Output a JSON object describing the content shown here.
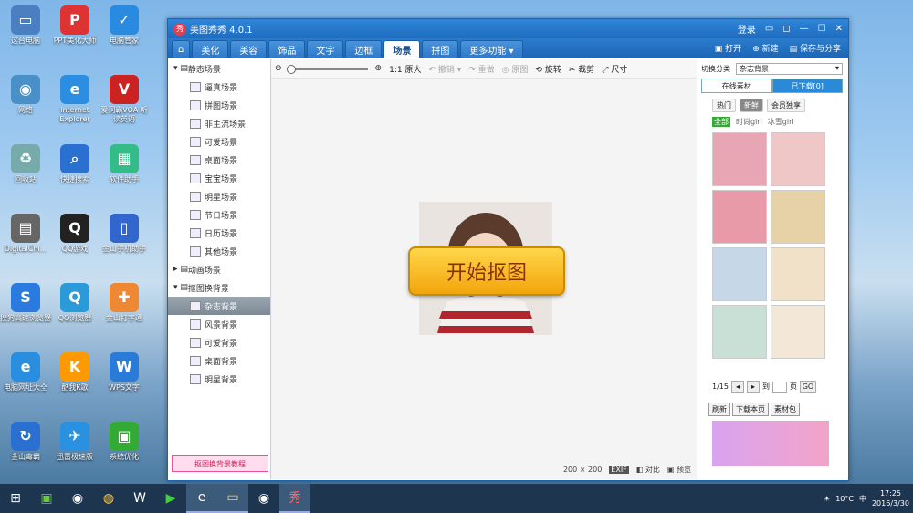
{
  "desktop": {
    "icons": [
      {
        "label": "这台电脑",
        "color": "#4a7fc1",
        "glyph": "▭"
      },
      {
        "label": "PPT美化大师",
        "color": "#d33",
        "glyph": "P"
      },
      {
        "label": "电脑管家",
        "color": "#2a8ae0",
        "glyph": "✓"
      },
      {
        "label": "网络",
        "color": "#4a90c8",
        "glyph": "◉"
      },
      {
        "label": "Internet Explorer",
        "color": "#2c8ee0",
        "glyph": "e"
      },
      {
        "label": "爱词霸VOA 听读英语",
        "color": "#c22",
        "glyph": "V"
      },
      {
        "label": "回收站",
        "color": "#7aa",
        "glyph": "♻"
      },
      {
        "label": "快捷搜索",
        "color": "#2a70d0",
        "glyph": "⌕"
      },
      {
        "label": "软件助手",
        "color": "#3b8",
        "glyph": "▦"
      },
      {
        "label": "DigitalChi...",
        "color": "#666",
        "glyph": "▤"
      },
      {
        "label": "QQ游戏",
        "color": "#222",
        "glyph": "Q"
      },
      {
        "label": "金山手机助手",
        "color": "#36c",
        "glyph": "▯"
      },
      {
        "label": "搜狗高速浏览器",
        "color": "#2a7ae0",
        "glyph": "S"
      },
      {
        "label": "QQ浏览器",
        "color": "#2a9ad8",
        "glyph": "Q"
      },
      {
        "label": "金山打字通",
        "color": "#e83",
        "glyph": "✚"
      },
      {
        "label": "电脑网址大全",
        "color": "#2a8ee0",
        "glyph": "e"
      },
      {
        "label": "酷我K歌",
        "color": "#f90",
        "glyph": "K"
      },
      {
        "label": "WPS文字",
        "color": "#2a7ad8",
        "glyph": "W"
      },
      {
        "label": "金山毒霸",
        "color": "#2a70d0",
        "glyph": "↻"
      },
      {
        "label": "迅雷极速版",
        "color": "#2a90e0",
        "glyph": "✈"
      },
      {
        "label": "系统优化",
        "color": "#3a3",
        "glyph": "▣"
      }
    ]
  },
  "app": {
    "title": "美图秀秀 4.0.1",
    "title_links": [
      "登录"
    ],
    "tabs": [
      {
        "label": "美化"
      },
      {
        "label": "美容"
      },
      {
        "label": "饰品"
      },
      {
        "label": "文字"
      },
      {
        "label": "边框"
      },
      {
        "label": "场景"
      },
      {
        "label": "拼图"
      },
      {
        "label": "更多功能 ▾"
      }
    ],
    "active_tab": "场景",
    "actions": {
      "open": "打开",
      "new": "新建",
      "save": "保存与分享"
    },
    "tree": {
      "static_header": "静态场景",
      "static_items": [
        "逼真场景",
        "拼图场景",
        "非主流场景",
        "可爱场景",
        "桌面场景",
        "宝宝场景",
        "明星场景",
        "节日场景",
        "日历场景",
        "其他场景"
      ],
      "animated": "动画场景",
      "cutout_header": "抠图换背景",
      "cutout_items": [
        "杂志背景",
        "风景背景",
        "可爱背景",
        "桌面背景",
        "明星背景"
      ],
      "selected": "杂志背景",
      "tutorial": "抠图换背景教程"
    },
    "toolbar": {
      "zoom_label": "1:1 原大",
      "undo": "撤销",
      "redo": "重做",
      "original": "原图",
      "rotate": "旋转",
      "crop": "裁剪",
      "resize": "尺寸"
    },
    "canvas": {
      "start_button": "开始抠图",
      "size": "200 × 200",
      "exif": "EXIF",
      "compare": "对比",
      "preview": "预览"
    },
    "right_panel": {
      "switch_label": "切换分类",
      "category": "杂志背景",
      "tabs": [
        "在线素材",
        "已下载[0]"
      ],
      "subtabs": [
        "热门",
        "新鲜",
        "会员独享"
      ],
      "filters": [
        "全部",
        "时尚girl",
        "冰雪girl"
      ],
      "thumb_colors": [
        "#e8a5b4",
        "#f0c7c7",
        "#e99aa8",
        "#e7d2a8",
        "#c6d8e8",
        "#f1e1c8",
        "#c8e0d6",
        "#f3e7d8"
      ],
      "pager": {
        "page": "1/15",
        "goto": "到",
        "page_unit": "页",
        "go": "GO"
      },
      "buttons": [
        "刷新",
        "下载本页",
        "素材包"
      ]
    }
  },
  "taskbar": {
    "clock_time": "17:25",
    "clock_date": "2016/3/30",
    "temp": "10°C",
    "ime": "中"
  }
}
